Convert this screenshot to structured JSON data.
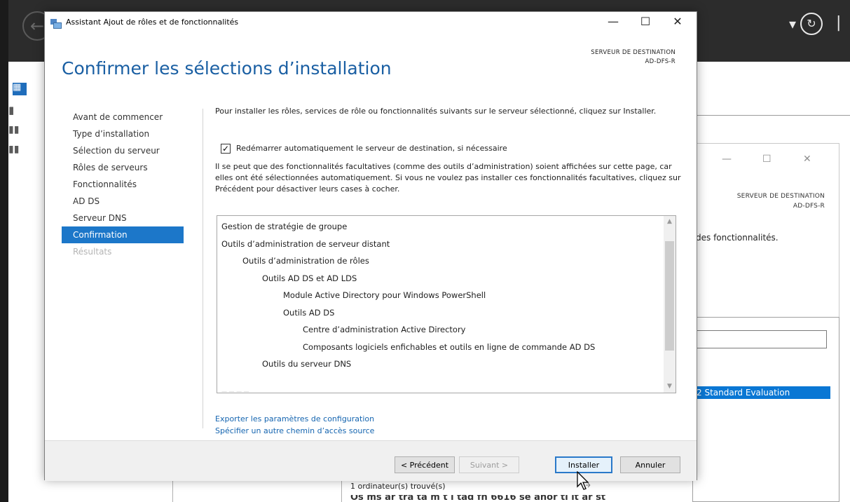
{
  "background": {
    "destination_label": "SERVEUR DE DESTINATION",
    "destination_server": "AD-DFS-R",
    "fragment_text": "des fonctionnalités.",
    "selected_row_text": "2 Standard Evaluation",
    "count_text": "1 ordinateur(s) trouvé(s)",
    "bottom_fragment": "Os ms ar tra ta m t l tad fn 6616 se anor ti lt ar st"
  },
  "wizard": {
    "window_title": "Assistant Ajout de rôles et de fonctionnalités",
    "page_title": "Confirmer les sélections d’installation",
    "destination_label": "SERVEUR DE DESTINATION",
    "destination_server": "AD-DFS-R",
    "steps": [
      {
        "label": "Avant de commencer",
        "state": "normal"
      },
      {
        "label": "Type d’installation",
        "state": "normal"
      },
      {
        "label": "Sélection du serveur",
        "state": "normal"
      },
      {
        "label": "Rôles de serveurs",
        "state": "normal"
      },
      {
        "label": "Fonctionnalités",
        "state": "normal"
      },
      {
        "label": "AD DS",
        "state": "normal"
      },
      {
        "label": "Serveur DNS",
        "state": "normal"
      },
      {
        "label": "Confirmation",
        "state": "active"
      },
      {
        "label": "Résultats",
        "state": "disabled"
      }
    ],
    "intro_text": "Pour installer les rôles, services de rôle ou fonctionnalités suivants sur le serveur sélectionné, cliquez sur Installer.",
    "restart_checkbox": {
      "label": "Redémarrer automatiquement le serveur de destination, si nécessaire",
      "checked": true
    },
    "optional_text": "Il se peut que des fonctionnalités facultatives (comme des outils d’administration) soient affichées sur cette page, car elles ont été sélectionnées automatiquement. Si vous ne voulez pas installer ces fonctionnalités facultatives, cliquez sur Précédent pour désactiver leurs cases à cocher.",
    "features": [
      {
        "label": "Gestion de stratégie de groupe",
        "level": 0
      },
      {
        "label": "Outils d’administration de serveur distant",
        "level": 0
      },
      {
        "label": "Outils d’administration de rôles",
        "level": 1
      },
      {
        "label": "Outils AD DS et AD LDS",
        "level": 2
      },
      {
        "label": "Module Active Directory pour Windows PowerShell",
        "level": 3
      },
      {
        "label": "Outils AD DS",
        "level": 3
      },
      {
        "label": "Centre d’administration Active Directory",
        "level": 4
      },
      {
        "label": "Composants logiciels enfichables et outils en ligne de commande AD DS",
        "level": 4
      },
      {
        "label": "Outils du serveur DNS",
        "level": 2
      }
    ],
    "links": {
      "export": "Exporter les paramètres de configuration",
      "alt_source": "Spécifier un autre chemin d’accès source"
    },
    "buttons": {
      "previous": "< Précédent",
      "next": "Suivant >",
      "install": "Installer",
      "cancel": "Annuler"
    }
  },
  "colors": {
    "accent": "#1c77c9",
    "title_blue": "#1a5fa3",
    "link": "#1565b0"
  }
}
